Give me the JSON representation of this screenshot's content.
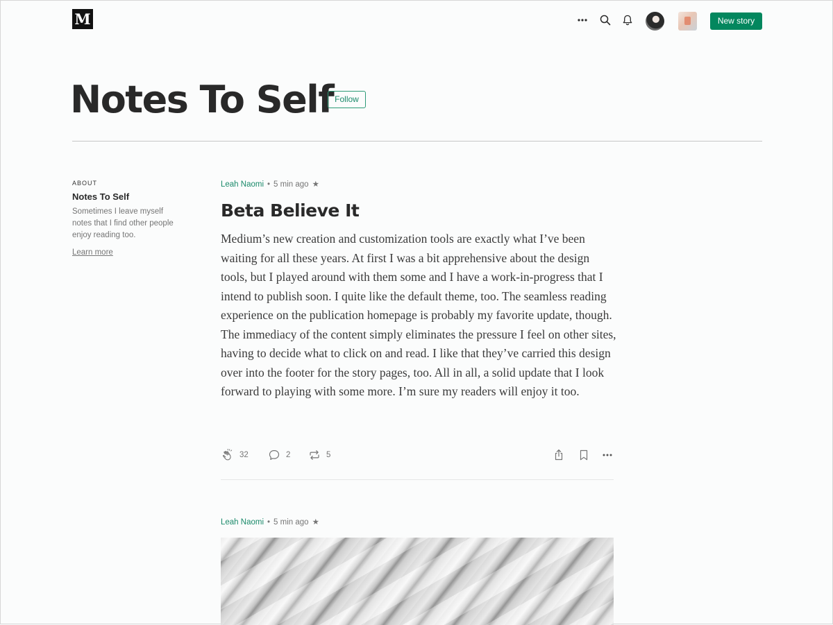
{
  "topbar": {
    "logo": "M",
    "icons": [
      "more-icon",
      "search-icon",
      "bell-icon"
    ],
    "new_story_label": "New story"
  },
  "publication": {
    "title": "Notes To Self",
    "follow_label": "Follow"
  },
  "about": {
    "label": "ABOUT",
    "name": "Notes To Self",
    "description": "Sometimes I leave myself notes that I find other people enjoy reading too.",
    "learn_more": "Learn more"
  },
  "stories": [
    {
      "author": "Leah Naomi",
      "time": "5 min ago",
      "star": "★",
      "title": "Beta Believe It",
      "body": "Medium’s new creation and customization tools are exactly what I’ve been waiting for all these years. At first I was a bit apprehensive about the design tools, but I played around with them some and I have a work-in-progress that I intend to publish soon. I quite like the default theme, too. The seamless reading experience on the publication homepage is probably my favorite update, though. The immediacy of the content simply eliminates the pressure I feel on other sites, having to decide what to click on and read. I like that they’ve carried this design over into the footer for the story pages, too. All in all, a solid update that I look forward to playing with some more. I’m sure my readers will enjoy it too.",
      "claps": "32",
      "responses": "2",
      "reposts": "5"
    },
    {
      "author": "Leah Naomi",
      "time": "5 min ago",
      "star": "★"
    }
  ],
  "colors": {
    "accent": "#03875e",
    "author_link": "#1a8a6a",
    "background": "#fbfcfc"
  }
}
